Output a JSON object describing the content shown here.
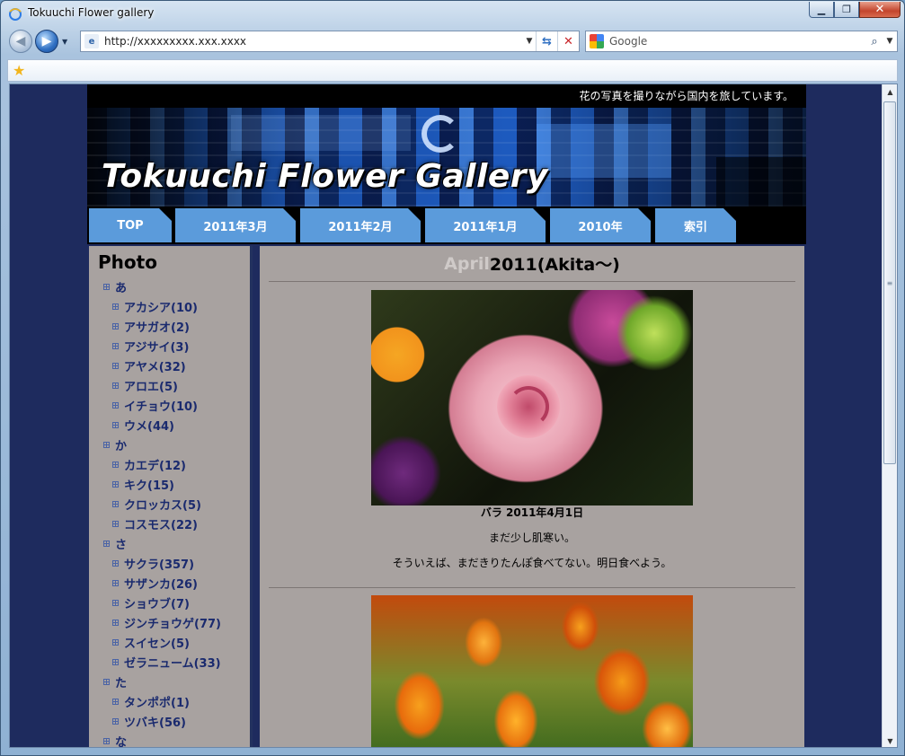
{
  "window": {
    "title": "Tokuuchi Flower gallery",
    "address": "http://xxxxxxxxx.xxx.xxxx",
    "search_placeholder": "Google"
  },
  "site": {
    "tagline": "花の写真を撮りながら国内を旅しています。",
    "banner_title": "Tokuuchi Flower Gallery",
    "nav_tabs": [
      "TOP",
      "2011年3月",
      "2011年2月",
      "2011年1月",
      "2010年",
      "索引"
    ]
  },
  "sidebar": {
    "title": "Photo",
    "items": [
      {
        "label": "あ",
        "level": 1
      },
      {
        "label": "アカシア(10)",
        "level": 2
      },
      {
        "label": "アサガオ(2)",
        "level": 2
      },
      {
        "label": "アジサイ(3)",
        "level": 2
      },
      {
        "label": "アヤメ(32)",
        "level": 2
      },
      {
        "label": "アロエ(5)",
        "level": 2
      },
      {
        "label": "イチョウ(10)",
        "level": 2
      },
      {
        "label": "ウメ(44)",
        "level": 2
      },
      {
        "label": "か",
        "level": 1
      },
      {
        "label": "カエデ(12)",
        "level": 2
      },
      {
        "label": "キク(15)",
        "level": 2
      },
      {
        "label": "クロッカス(5)",
        "level": 2
      },
      {
        "label": "コスモス(22)",
        "level": 2
      },
      {
        "label": "さ",
        "level": 1
      },
      {
        "label": "サクラ(357)",
        "level": 2
      },
      {
        "label": "サザンカ(26)",
        "level": 2
      },
      {
        "label": "ショウブ(7)",
        "level": 2
      },
      {
        "label": "ジンチョウゲ(77)",
        "level": 2
      },
      {
        "label": "スイセン(5)",
        "level": 2
      },
      {
        "label": "ゼラニューム(33)",
        "level": 2
      },
      {
        "label": "た",
        "level": 1
      },
      {
        "label": "タンポポ(1)",
        "level": 2
      },
      {
        "label": "ツバキ(56)",
        "level": 2
      },
      {
        "label": "な",
        "level": 1
      }
    ]
  },
  "content": {
    "title_muted": "April",
    "title_main": "2011(Akita～)",
    "post1": {
      "caption_title": "バラ  2011年4月1日",
      "line1": "まだ少し肌寒い。",
      "line2": "そういえば、まだきりたんぽ食べてない。明日食べよう。"
    }
  }
}
